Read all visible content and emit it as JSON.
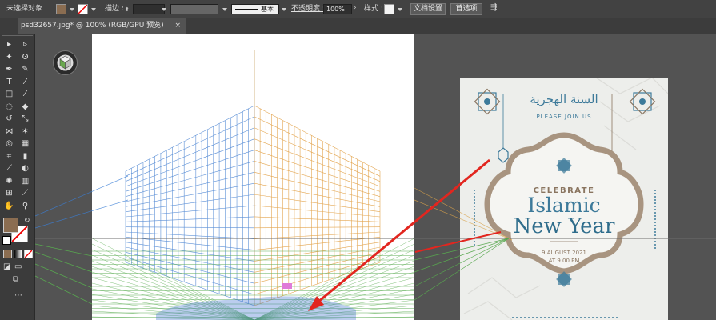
{
  "control_bar": {
    "selection_status": "未选择对象",
    "stroke_label": "描边 :",
    "stroke_style": "基本",
    "opacity_label": "不透明度 :",
    "opacity_value": "100%",
    "style_label": "样式 :",
    "document_setup": "文档设置",
    "preferences": "首选项",
    "fill_color": "#8b6d51"
  },
  "document_tab": {
    "title": "psd32657.jpg* @ 100% (RGB/GPU 预览)",
    "close": "×"
  },
  "tools": [
    {
      "name": "selection-tool-icon",
      "glyph": "▸"
    },
    {
      "name": "direct-selection-tool-icon",
      "glyph": "▹"
    },
    {
      "name": "magic-wand-tool-icon",
      "glyph": "✦"
    },
    {
      "name": "lasso-tool-icon",
      "glyph": "ʘ"
    },
    {
      "name": "pen-tool-icon",
      "glyph": "✒"
    },
    {
      "name": "curvature-tool-icon",
      "glyph": "✎"
    },
    {
      "name": "type-tool-icon",
      "glyph": "T"
    },
    {
      "name": "line-tool-icon",
      "glyph": "⁄"
    },
    {
      "name": "rectangle-tool-icon",
      "glyph": "□"
    },
    {
      "name": "paintbrush-tool-icon",
      "glyph": "⁄"
    },
    {
      "name": "shaper-tool-icon",
      "glyph": "◌"
    },
    {
      "name": "eraser-tool-icon",
      "glyph": "◆"
    },
    {
      "name": "rotate-tool-icon",
      "glyph": "↺"
    },
    {
      "name": "scale-tool-icon",
      "glyph": "⤡"
    },
    {
      "name": "width-tool-icon",
      "glyph": "⋈"
    },
    {
      "name": "puppet-warp-tool-icon",
      "glyph": "✶"
    },
    {
      "name": "shape-builder-tool-icon",
      "glyph": "◎"
    },
    {
      "name": "perspective-grid-tool-icon",
      "glyph": "▦"
    },
    {
      "name": "mesh-tool-icon",
      "glyph": "⌗"
    },
    {
      "name": "gradient-tool-icon",
      "glyph": "▮"
    },
    {
      "name": "eyedropper-tool-icon",
      "glyph": "⟋"
    },
    {
      "name": "blend-tool-icon",
      "glyph": "◐"
    },
    {
      "name": "symbol-sprayer-tool-icon",
      "glyph": "✺"
    },
    {
      "name": "column-graph-tool-icon",
      "glyph": "▥"
    },
    {
      "name": "artboard-tool-icon",
      "glyph": "⊞"
    },
    {
      "name": "slice-tool-icon",
      "glyph": "⟋"
    },
    {
      "name": "hand-tool-icon",
      "glyph": "✋"
    },
    {
      "name": "zoom-tool-icon",
      "glyph": "⚲"
    }
  ],
  "flyer": {
    "arabic_title": "السنة الهجرية",
    "please_join": "PLEASE JOIN US",
    "celebrate": "CELEBRATE",
    "islamic": "Islamic",
    "new_year": "New Year",
    "date": "9 AUGUST 2021",
    "time": "AT 9.00 PM",
    "brand_color": "#8a7560",
    "accent_color": "#3d7a9a"
  }
}
